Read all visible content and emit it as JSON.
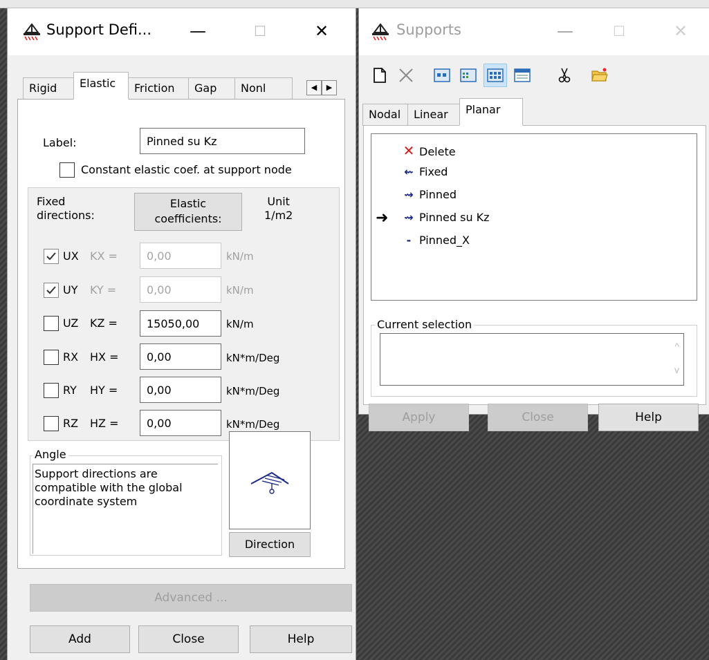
{
  "support_definition": {
    "title": "Support Defi...",
    "controls": {
      "minimize": "—",
      "maximize": "☐",
      "close": "✕"
    },
    "tabs": [
      "Rigid",
      "Elastic",
      "Friction",
      "Gap",
      "Nonl"
    ],
    "active_tab": "Elastic",
    "label_caption": "Label:",
    "label_value": "Pinned su Kz",
    "constant_checkbox": "Constant elastic coef. at support node",
    "fixed_directions": "Fixed\ndirections:",
    "elastic_coefficients_button": "Elastic\ncoefficients:",
    "unit_header": "Unit\n1/m2",
    "rows": [
      {
        "dir": "UX",
        "coef": "KX =",
        "value": "0,00",
        "unit": "kN/m",
        "checked": true,
        "enabled": false
      },
      {
        "dir": "UY",
        "coef": "KY =",
        "value": "0,00",
        "unit": "kN/m",
        "checked": true,
        "enabled": false
      },
      {
        "dir": "UZ",
        "coef": "KZ =",
        "value": "15050,00",
        "unit": "kN/m",
        "checked": false,
        "enabled": true
      },
      {
        "dir": "RX",
        "coef": "HX =",
        "value": "0,00",
        "unit": "kN*m/Deg",
        "checked": false,
        "enabled": true
      },
      {
        "dir": "RY",
        "coef": "HY =",
        "value": "0,00",
        "unit": "kN*m/Deg",
        "checked": false,
        "enabled": true
      },
      {
        "dir": "RZ",
        "coef": "HZ =",
        "value": "0,00",
        "unit": "kN*m/Deg",
        "checked": false,
        "enabled": true
      }
    ],
    "angle_group": "Angle",
    "angle_text": "Support directions are compatible with the global coordinate system",
    "direction_button": "Direction",
    "advanced_button": "Advanced ...",
    "add_button": "Add",
    "close_button": "Close",
    "help_button": "Help"
  },
  "supports": {
    "title": "Supports",
    "controls": {
      "minimize": "—",
      "maximize": "☐",
      "close": "✕"
    },
    "toolbar": [
      "new-document-icon",
      "delete-x-icon",
      "view-small-icon",
      "view-list-icon",
      "view-grid-icon",
      "view-table-icon",
      "cut-icon",
      "open-folder-icon"
    ],
    "tabs": [
      "Nodal",
      "Linear",
      "Planar"
    ],
    "active_tab": "Planar",
    "list_items": [
      {
        "label": "Delete",
        "icon": "delete-icon"
      },
      {
        "label": "Fixed",
        "icon": "fixed-support-icon"
      },
      {
        "label": "Pinned",
        "icon": "pinned-support-icon"
      },
      {
        "label": "Pinned su Kz",
        "icon": "pinned-support-icon",
        "pointed": true
      },
      {
        "label": "Pinned_X",
        "icon": "pinned-x-support-icon"
      }
    ],
    "current_selection_group": "Current selection",
    "current_selection_value": "",
    "apply_button": "Apply",
    "close_button": "Close",
    "help_button": "Help"
  },
  "colors": {
    "accent_blue": "#1b2a8a",
    "delete_red": "#d11a1a",
    "window_bg": "#f0f0f0"
  }
}
